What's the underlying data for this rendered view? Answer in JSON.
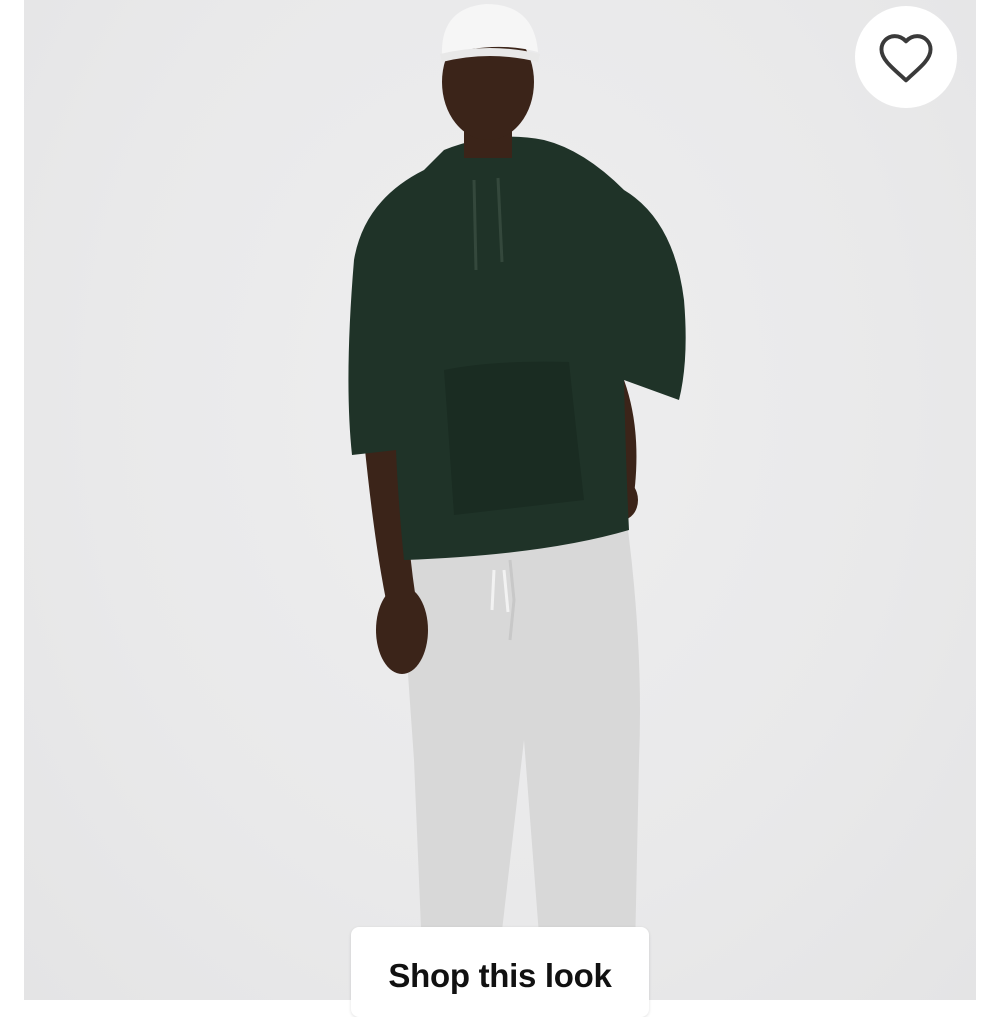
{
  "product_image": {
    "alt": "",
    "cap_logo": "",
    "colors": {
      "background": "#e9e9ea",
      "hoodie": "#1f3328",
      "pants": "#d6d6d6",
      "cap": "#f6f6f6",
      "skin": "#3b2419"
    }
  },
  "favorite": {
    "icon": "heart-outline-icon",
    "color": "#3a3a3a"
  },
  "cta": {
    "label": "Shop this look"
  }
}
